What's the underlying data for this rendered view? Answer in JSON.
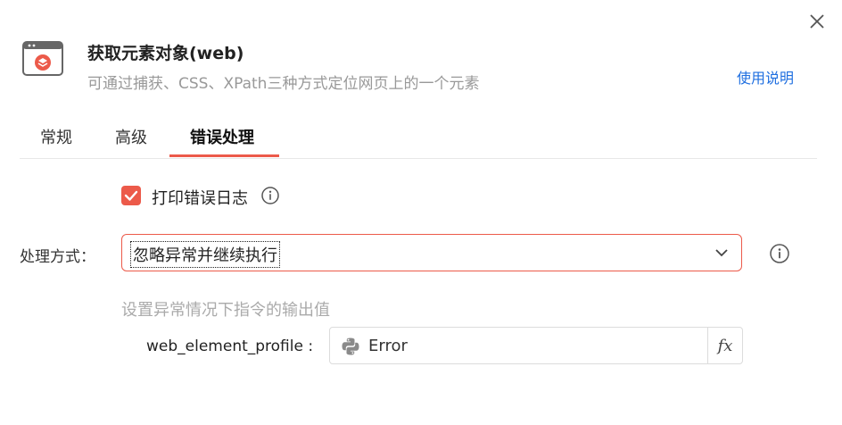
{
  "header": {
    "title": "获取元素对象(web)",
    "subtitle": "可通过捕获、CSS、XPath三种方式定位网页上的一个元素",
    "help_link": "使用说明",
    "icon": "web-element-icon"
  },
  "tabs": [
    {
      "label": "常规",
      "active": false
    },
    {
      "label": "高级",
      "active": false
    },
    {
      "label": "错误处理",
      "active": true
    }
  ],
  "error_handling": {
    "print_log": {
      "label": "打印错误日志",
      "checked": true
    },
    "mode_label": "处理方式：",
    "mode_value": "忽略异常并继续执行",
    "output_hint": "设置异常情况下指令的输出值",
    "params": [
      {
        "name": "web_element_profile :",
        "value": "Error",
        "fx_label": "fx"
      }
    ]
  },
  "colors": {
    "accent": "#ec5a4a",
    "link": "#1f6fe0"
  }
}
